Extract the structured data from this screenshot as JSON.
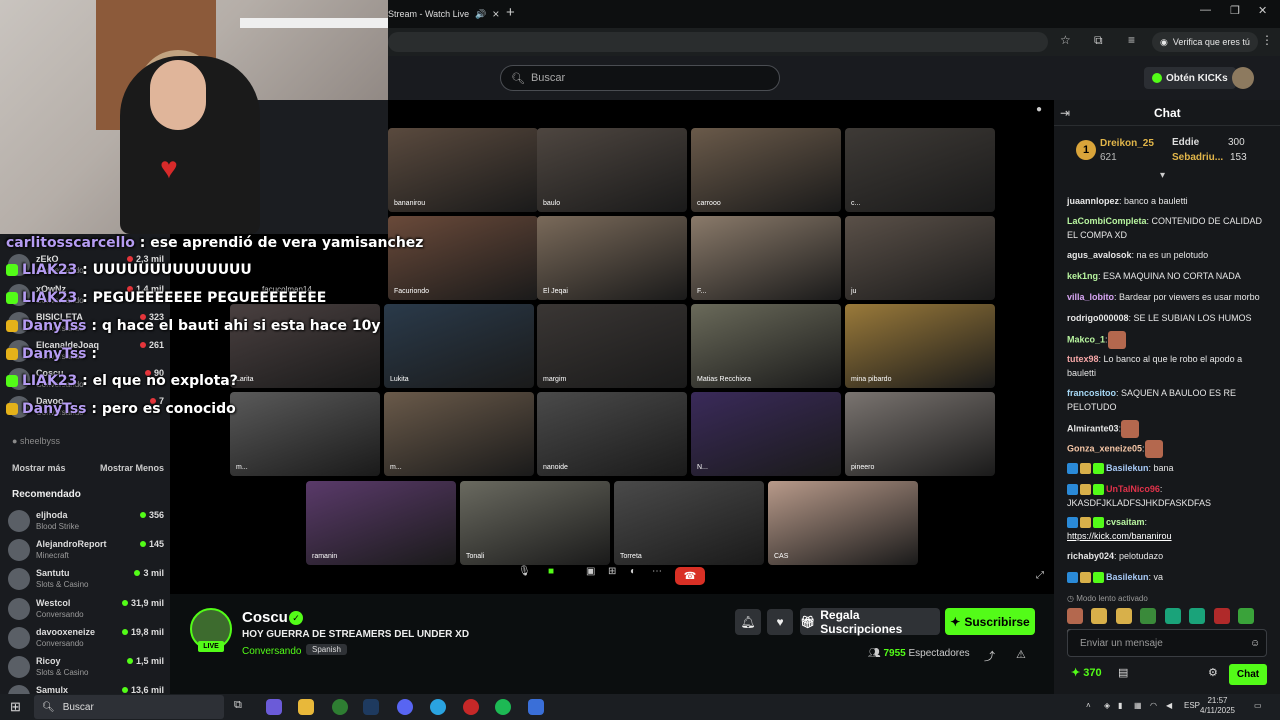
{
  "browser": {
    "tab_title": "Stream - Watch Live",
    "new_tab": "+",
    "verify_label": "Verifica que eres tú"
  },
  "header": {
    "search_placeholder": "Buscar",
    "kicks_label": "Obtén KICKs"
  },
  "sidebar": {
    "following": [
      {
        "name": "zEkO",
        "viewers": "2,3 mil"
      },
      {
        "name": "xOwNz",
        "viewers": "1,4 mil"
      },
      {
        "name": "BISICLETA",
        "viewers": "323"
      },
      {
        "name": "ElcanaldeJoaq",
        "viewers": "261"
      },
      {
        "name": "Coscu",
        "viewers": "90"
      },
      {
        "name": "Davoo",
        "viewers": "7"
      }
    ],
    "offline": "sheelbyss",
    "conversando_label": "Conversando",
    "show_more": "Mostrar más",
    "show_less": "Mostrar Menos",
    "recommended_title": "Recomendado",
    "recommended": [
      {
        "name": "eljhoda",
        "game": "Blood Strike",
        "viewers": "356"
      },
      {
        "name": "AlejandroReport",
        "game": "Minecraft",
        "viewers": "145"
      },
      {
        "name": "Santutu",
        "game": "Slots & Casino",
        "viewers": "3 mil"
      },
      {
        "name": "Westcol",
        "game": "Conversando",
        "viewers": "31,9 mil"
      },
      {
        "name": "davooxeneize",
        "game": "Conversando",
        "viewers": "19,8 mil"
      },
      {
        "name": "Ricoy",
        "game": "Slots & Casino",
        "viewers": "1,5 mil"
      },
      {
        "name": "Samulx",
        "game": "",
        "viewers": "13,6 mil"
      }
    ]
  },
  "overlay_chat": [
    {
      "user": "carlitosscarcello",
      "text": " : ese aprendió de vera yamisanchez",
      "user_color": "#b59cf2"
    },
    {
      "user": "LIAK23",
      "text": " : UUUUUUUUUUUUUU",
      "user_color": "#b59cf2"
    },
    {
      "user": "LIAK23",
      "text": " : PEGUEEEEEEE PEGUEEEEEEEE",
      "user_color": "#b59cf2"
    },
    {
      "user": "DanyTss",
      "text": " : q hace el bauti ahi si esta hace 10y",
      "user_color": "#b59cf2"
    },
    {
      "user": "DanyTss",
      "text": " : ",
      "user_color": "#b59cf2"
    },
    {
      "user": "LIAK23",
      "text": " : el que no explota?",
      "user_color": "#b59cf2"
    },
    {
      "user": "DanyTss",
      "text": " : pero es conocido",
      "user_color": "#b59cf2"
    }
  ],
  "meet_tiles": [
    {
      "name": "bananirou"
    },
    {
      "name": "baulo"
    },
    {
      "name": "carrooo"
    },
    {
      "name": "c..."
    },
    {
      "name": "Facuriondo"
    },
    {
      "name": "El Jeqai"
    },
    {
      "name": "F..."
    },
    {
      "name": "ju"
    },
    {
      "name": "Larita"
    },
    {
      "name": "Lukita"
    },
    {
      "name": "margim"
    },
    {
      "name": "Matias Recchiora"
    },
    {
      "name": "mina pibardo"
    },
    {
      "name": "m..."
    },
    {
      "name": "m..."
    },
    {
      "name": "nanoide"
    },
    {
      "name": "N..."
    },
    {
      "name": "pineero"
    },
    {
      "name": "ramanin"
    },
    {
      "name": "Tonali"
    },
    {
      "name": "Torreta"
    },
    {
      "name": "CAS"
    }
  ],
  "meet_side_names": [
    "facucolman14"
  ],
  "channel": {
    "name": "Coscu",
    "live_label": "LIVE",
    "title": "HOY GUERRA DE STREAMERS DEL UNDER XD",
    "category": "Conversando",
    "language": "Spanish",
    "gift_label": "Regala Suscripciones",
    "subscribe_label": "Suscribirse",
    "viewers_count": "7955",
    "viewers_label": "Espectadores"
  },
  "chat": {
    "title": "Chat",
    "leaderboard": [
      {
        "rank": "1",
        "name": "Dreikon_25",
        "points": "621"
      },
      {
        "name": "Eddie",
        "points": "300"
      },
      {
        "name": "Sebadriu...",
        "points": "153"
      }
    ],
    "messages": [
      {
        "user": "juaannlopez",
        "text": ": banco a bauletti",
        "color": "#e6e6e6"
      },
      {
        "user": "LaCombiCompleta",
        "text": ": CONTENIDO DE CALIDAD EL COMPA XD",
        "color": "#b8f5a0"
      },
      {
        "user": "agus_avalosok",
        "text": ": na es un pelotudo",
        "color": "#e6e6e6"
      },
      {
        "user": "kek1ng",
        "text": ": ESA MAQUINA NO CORTA NADA",
        "color": "#b8f5a0"
      },
      {
        "user": "villa_lobito",
        "text": ": Bardear por viewers es usar morbo",
        "color": "#d9a6f5"
      },
      {
        "user": "rodrigo000008",
        "text": ": SE LE SUBIAN LOS HUMOS",
        "color": "#e6e6e6"
      },
      {
        "user": "Makco_1",
        "text": ":",
        "color": "#b8f5a0"
      },
      {
        "user": "tutex98",
        "text": ": Lo banco al que le robo el apodo a bauletti",
        "color": "#f5a6a6"
      },
      {
        "user": "francositoo",
        "text": ": SAQUEN A BAULOO ES RE PELOTUDO",
        "color": "#a6d8f5"
      },
      {
        "user": "Almirante03",
        "text": ":",
        "color": "#e6e6e6"
      },
      {
        "user": "Gonza_xeneize05",
        "text": ":",
        "color": "#f5c6a6"
      },
      {
        "user": "Basilekun",
        "text": ": bana",
        "color": "#a6c8f5"
      },
      {
        "user": "UnTalNico96",
        "text": ": JKASDFJKLADFSJHKDFASKDFAS",
        "color": "#e0324a"
      },
      {
        "user": "cvsaitam",
        "text": ":",
        "color": "#b8f5a0"
      },
      {
        "user": "link",
        "text": "https://kick.com/bananirou",
        "color": "#ffffff"
      },
      {
        "user": "richaby024",
        "text": ": pelotudazo",
        "color": "#e6e6e6"
      },
      {
        "user": "Basilekun",
        "text": ": va",
        "color": "#a6c8f5"
      }
    ],
    "slow_mode": "Modo lento activado",
    "input_placeholder": "Enviar un mensaje",
    "points": "370",
    "send_label": "Chat"
  },
  "taskbar": {
    "search_label": "Buscar",
    "lang": "ESP",
    "time": "21:57",
    "date": "4/11/2025"
  }
}
